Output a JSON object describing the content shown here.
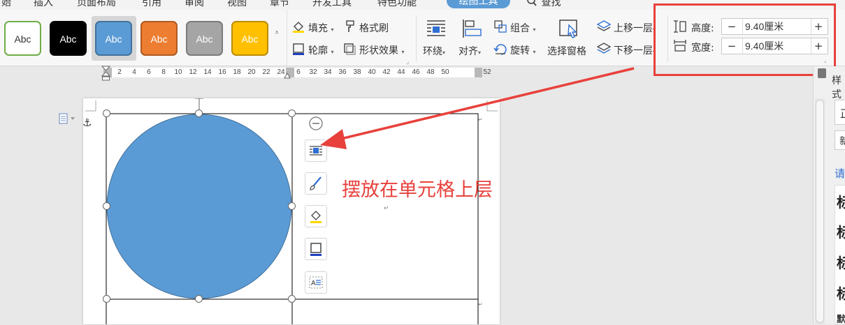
{
  "menu": {
    "items": [
      "始",
      "插入",
      "页面布局",
      "引用",
      "审阅",
      "视图",
      "章节",
      "开发工具",
      "特色功能"
    ],
    "active_tab": "绘图工具",
    "search": "查找"
  },
  "shape_styles": [
    {
      "label": "Abc",
      "bg": "#ffffff",
      "fg": "#333333",
      "border": "#70ad47"
    },
    {
      "label": "Abc",
      "bg": "#000000",
      "fg": "#ffffff",
      "border": "#000000"
    },
    {
      "label": "Abc",
      "bg": "#5b9bd5",
      "fg": "#ffffff",
      "border": "#41719c"
    },
    {
      "label": "Abc",
      "bg": "#ed7d31",
      "fg": "#ffffff",
      "border": "#ae5a21"
    },
    {
      "label": "Abc",
      "bg": "#a5a5a5",
      "fg": "#ffffff",
      "border": "#7b7b7b"
    },
    {
      "label": "Abc",
      "bg": "#ffc000",
      "fg": "#ffffff",
      "border": "#bc8c00"
    }
  ],
  "ribbon": {
    "fill": "填充",
    "format_painter": "格式刷",
    "outline": "轮廓",
    "shape_effects": "形状效果",
    "wrap": "环绕",
    "align": "对齐",
    "group": "组合",
    "rotate": "旋转",
    "selection_pane": "选择窗格",
    "bring_forward": "上移一层",
    "send_backward": "下移一层",
    "height_label": "高度:",
    "height_value": "9.40厘米",
    "width_label": "宽度:",
    "width_value": "9.40厘米",
    "minus": "−",
    "plus": "+"
  },
  "ruler": [
    "2",
    "4",
    "6",
    "8",
    "10",
    "12",
    "14",
    "16",
    "18",
    "20",
    "22",
    "24",
    "6",
    "32",
    "34",
    "36",
    "38",
    "40",
    "42",
    "44",
    "46",
    "48",
    "50",
    "52"
  ],
  "annotation": {
    "text": "摆放在单元格上层",
    "color": "#e8413c"
  },
  "shape": {
    "fill": "#5b9bd5",
    "stroke": "#41719c"
  },
  "right_panel": {
    "top": "样式",
    "box1": "正",
    "box2": "新",
    "link": "请",
    "big": [
      "标",
      "标",
      "标",
      "标"
    ],
    "small": "默"
  },
  "colors": {
    "highlight": "#e8413c",
    "accent": "#5b9bd5"
  }
}
